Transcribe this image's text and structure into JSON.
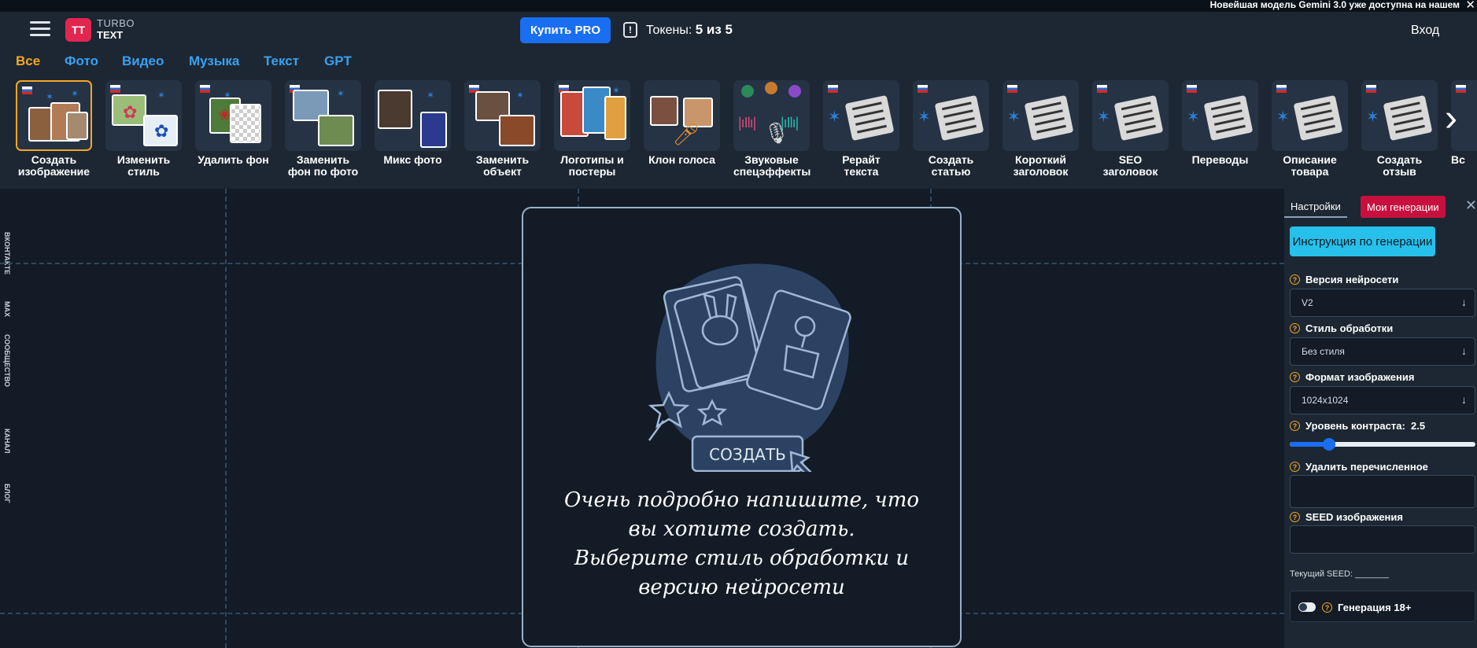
{
  "banner": {
    "text": "Новейшая модель Gemini 3.0 уже доступна на нашем",
    "close": "✕"
  },
  "header": {
    "logo_mark": "TT",
    "logo_line1": "TURBO",
    "logo_line2": "TEXT",
    "buy_pro": "Купить PRO",
    "tokens_label": "Токены:",
    "tokens_value": "5 из 5",
    "login": "Вход"
  },
  "categories": [
    {
      "label": "Все",
      "active": true
    },
    {
      "label": "Фото"
    },
    {
      "label": "Видео"
    },
    {
      "label": "Музыка"
    },
    {
      "label": "Текст"
    },
    {
      "label": "GPT"
    }
  ],
  "tools": [
    {
      "l1": "Создать",
      "l2": "изображение",
      "active": true,
      "icon": "create-image-icon"
    },
    {
      "l1": "Изменить",
      "l2": "стиль",
      "icon": "change-style-icon"
    },
    {
      "l1": "Удалить фон",
      "l2": "",
      "icon": "remove-bg-icon"
    },
    {
      "l1": "Заменить",
      "l2": "фон по фото",
      "icon": "replace-bg-icon"
    },
    {
      "l1": "Микс фото",
      "l2": "",
      "icon": "mix-photo-icon"
    },
    {
      "l1": "Заменить",
      "l2": "объект",
      "icon": "replace-object-icon"
    },
    {
      "l1": "Логотипы и",
      "l2": "постеры",
      "icon": "logos-posters-icon"
    },
    {
      "l1": "Клон голоса",
      "l2": "",
      "icon": "voice-clone-icon"
    },
    {
      "l1": "Звуковые",
      "l2": "спецэффекты",
      "icon": "sound-effects-icon"
    },
    {
      "l1": "Рерайт",
      "l2": "текста",
      "icon": "rewrite-text-icon"
    },
    {
      "l1": "Создать",
      "l2": "статью",
      "icon": "create-article-icon"
    },
    {
      "l1": "Короткий",
      "l2": "заголовок",
      "icon": "short-title-icon"
    },
    {
      "l1": "SEO",
      "l2": "заголовок",
      "icon": "seo-title-icon"
    },
    {
      "l1": "Переводы",
      "l2": "",
      "icon": "translations-icon"
    },
    {
      "l1": "Описание",
      "l2": "товара",
      "icon": "product-description-icon"
    },
    {
      "l1": "Создать",
      "l2": "отзыв",
      "icon": "create-review-icon"
    },
    {
      "l1": "Вс",
      "l2": "",
      "icon": "more-icon"
    }
  ],
  "side_social": [
    "ВКОНТАКТЕ",
    "MAX",
    "СООБЩЕСТВО",
    "КАНАЛ",
    "БЛОГ"
  ],
  "canvas": {
    "illustration_button": "СОЗДАТЬ",
    "text_line1": "Очень подробно напишите, что",
    "text_line2": "вы хотите создать.",
    "text_line3": "Выберите стиль обработки и",
    "text_line4": "версию нейросети"
  },
  "panel": {
    "tab_settings": "Настройки",
    "tab_generations": "Мои генерации",
    "close": "✕",
    "instruction_button": "Инструкция по генерации",
    "model_label": "Версия нейросети",
    "model_value": "V2",
    "style_label": "Стиль обработки",
    "style_value": "Без стиля",
    "format_label": "Формат изображения",
    "format_value": "1024x1024",
    "contrast_label": "Уровень контраста:",
    "contrast_value": "2.5",
    "contrast_fraction": 0.21,
    "negative_label": "Удалить перечисленное",
    "seed_label": "SEED изображения",
    "seed_current": "Текущий SEED: _______",
    "adult_label": "Генерация 18+"
  },
  "colors": {
    "accent": "#f5a623",
    "blue": "#1a6ef2",
    "cyan": "#27c0ea",
    "red": "#c8103e",
    "bg": "#121b26",
    "panel": "#1c2733"
  }
}
